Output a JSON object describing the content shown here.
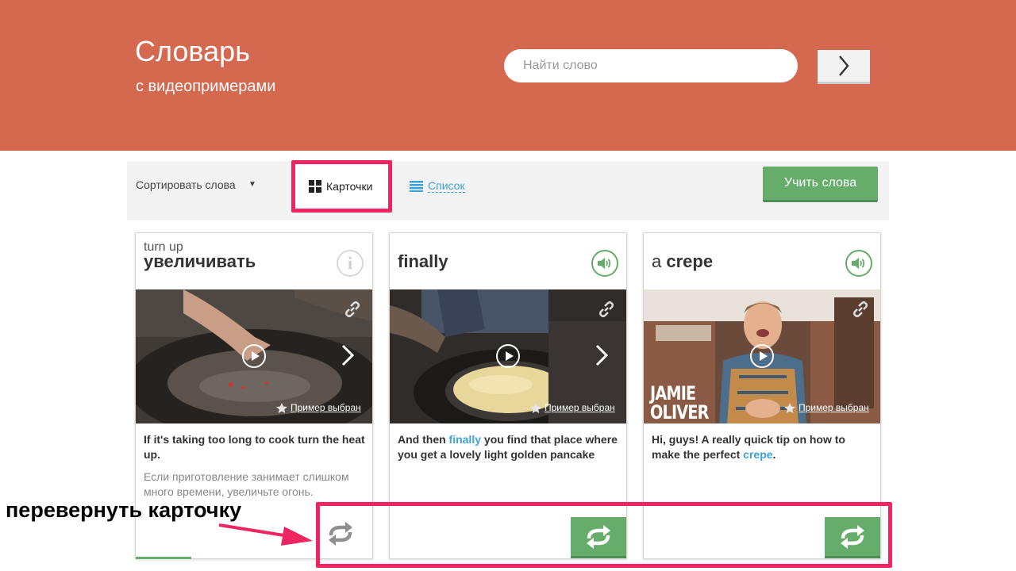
{
  "header": {
    "title": "Словарь",
    "subtitle": "с видеопримерами",
    "search_placeholder": "Найти слово",
    "background": "#d5694f"
  },
  "toolbar": {
    "sort_label": "Сортировать слова",
    "cards_label": "Карточки",
    "list_label": "Список",
    "learn_label": "Учить слова"
  },
  "cards": [
    {
      "translation": "turn up",
      "word": "увеличивать",
      "picked_label": "Пример выбран",
      "example_en": "If it's taking too long to cook turn the heat up.",
      "example_ru": "Если приготовление занимает слишком много времени, увеличьте огонь."
    },
    {
      "word": "finally",
      "picked_label": "Пример выбран",
      "example_before": "And then ",
      "example_highlight": "finally",
      "example_after": " you find that place where you get a lovely light golden pancake"
    },
    {
      "article": "a ",
      "word": "crepe",
      "picked_label": "Пример выбран",
      "overlay_text_1": "JAMIE",
      "overlay_text_2": "OLIVER",
      "example_before": "Hi, guys! A really quick tip on how to make the perfect ",
      "example_highlight": "crepe",
      "example_after": "."
    }
  ],
  "annotation": {
    "text": "перевернуть карточку",
    "color": "#ee2561"
  },
  "accent_green": "#66ad6c",
  "accent_blue": "#3ea3d8"
}
